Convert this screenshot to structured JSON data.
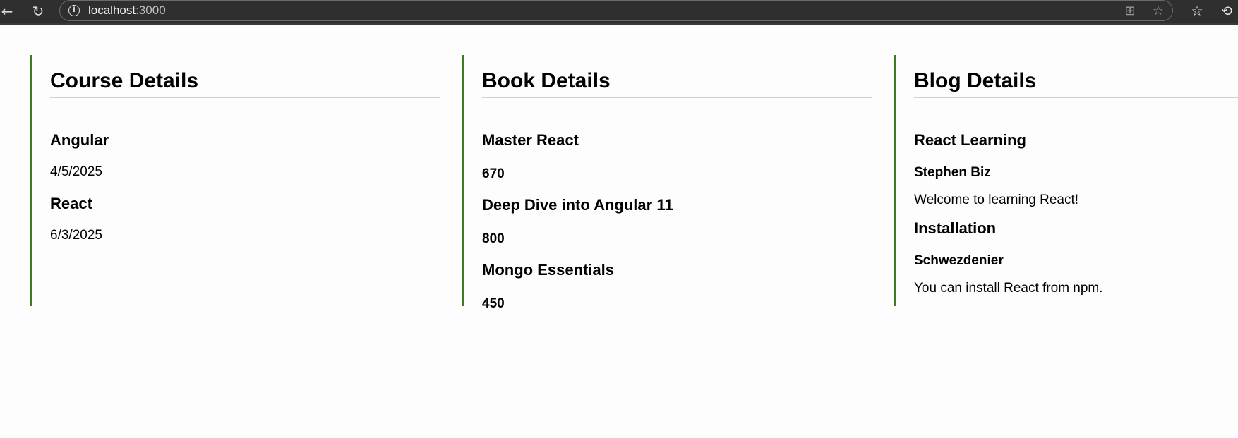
{
  "browser": {
    "url_host": "localhost",
    "url_port": ":3000"
  },
  "course": {
    "heading": "Course Details",
    "items": [
      {
        "name": "Angular",
        "date": "4/5/2025"
      },
      {
        "name": "React",
        "date": "6/3/2025"
      }
    ]
  },
  "book": {
    "heading": "Book Details",
    "items": [
      {
        "name": "Master React",
        "price": "670"
      },
      {
        "name": "Deep Dive into Angular 11",
        "price": "800"
      },
      {
        "name": "Mongo Essentials",
        "price": "450"
      }
    ]
  },
  "blog": {
    "heading": "Blog Details",
    "items": [
      {
        "title": "React Learning",
        "author": "Stephen Biz",
        "text": "Welcome to learning React!"
      },
      {
        "title": "Installation",
        "author": "Schwezdenier",
        "text": "You can install React from npm."
      }
    ]
  },
  "colors": {
    "accent_border": "#3a7d1f",
    "browser_bar": "#2f2f2f"
  }
}
